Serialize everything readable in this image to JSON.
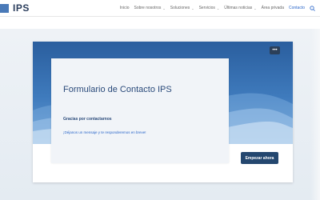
{
  "header": {
    "logo_text": "IPS",
    "nav": [
      {
        "label": "Inicio",
        "has_dropdown": false,
        "active": false
      },
      {
        "label": "Sobre nosotros",
        "has_dropdown": true,
        "active": false
      },
      {
        "label": "Soluciones",
        "has_dropdown": true,
        "active": false
      },
      {
        "label": "Servicios",
        "has_dropdown": true,
        "active": false
      },
      {
        "label": "Últimas noticias",
        "has_dropdown": true,
        "active": false
      },
      {
        "label": "Área privada",
        "has_dropdown": false,
        "active": false
      },
      {
        "label": "Contacto",
        "has_dropdown": false,
        "active": true
      }
    ],
    "search_icon": "search-icon"
  },
  "card": {
    "title": "Formulario de Contacto IPS",
    "subtitle": "Gracias por contactarnos",
    "text": "¡Déjanos un mensaje y te responderemos en breve!",
    "menu_icon": "more-icon",
    "menu_glyph": "•••",
    "start_button_label": "Empezar ahora"
  },
  "colors": {
    "accent": "#2a66c9",
    "banner": "#3f7bbd",
    "button": "#24476f"
  }
}
